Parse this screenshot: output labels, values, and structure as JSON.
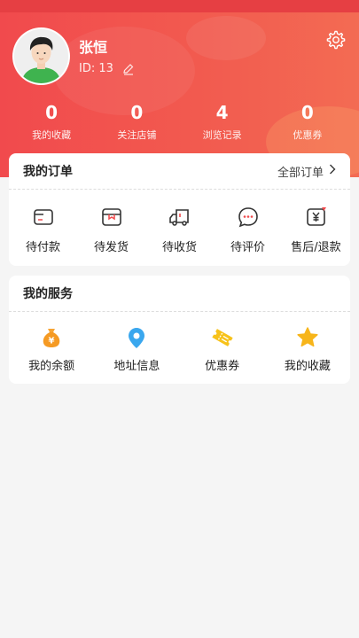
{
  "user": {
    "name": "张恒",
    "id_label": "ID: 13"
  },
  "stats": [
    {
      "value": "0",
      "label": "我的收藏"
    },
    {
      "value": "0",
      "label": "关注店铺"
    },
    {
      "value": "4",
      "label": "浏览记录"
    },
    {
      "value": "0",
      "label": "优惠券"
    }
  ],
  "orders": {
    "title": "我的订单",
    "all_link": "全部订单",
    "items": [
      {
        "label": "待付款",
        "icon": "wallet-icon"
      },
      {
        "label": "待发货",
        "icon": "package-icon"
      },
      {
        "label": "待收货",
        "icon": "truck-icon"
      },
      {
        "label": "待评价",
        "icon": "comment-icon"
      },
      {
        "label": "售后/退款",
        "icon": "refund-icon"
      }
    ]
  },
  "services": {
    "title": "我的服务",
    "items": [
      {
        "label": "我的余额",
        "icon": "money-bag-icon"
      },
      {
        "label": "地址信息",
        "icon": "location-pin-icon"
      },
      {
        "label": "优惠券",
        "icon": "coupon-icon"
      },
      {
        "label": "我的收藏",
        "icon": "star-icon"
      }
    ]
  },
  "colors": {
    "header": "#f14a4d",
    "icon_orange": "#f59a23",
    "icon_blue": "#3aa7ee",
    "icon_yellow": "#f7c21a"
  }
}
